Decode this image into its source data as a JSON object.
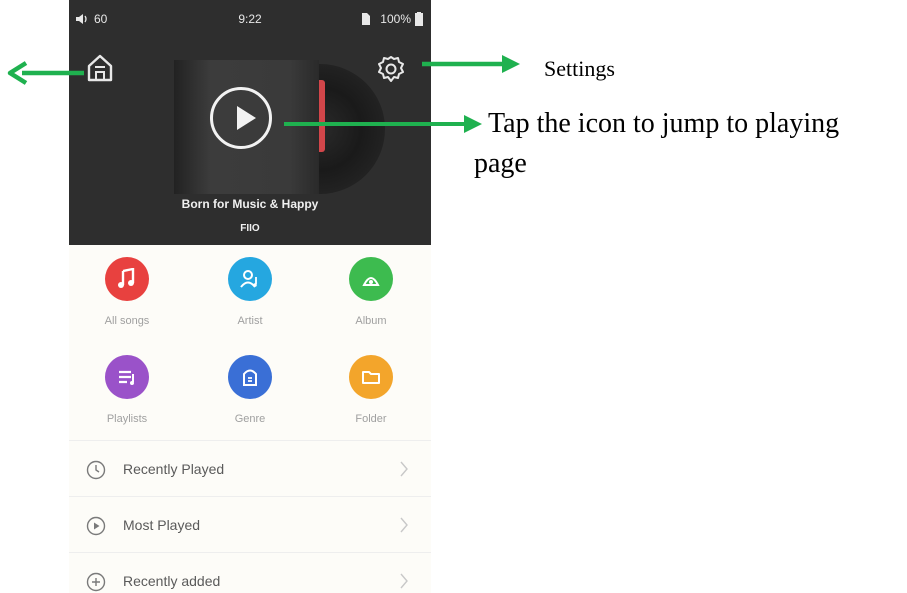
{
  "status_bar": {
    "volume": "60",
    "time": "9:22",
    "battery": "100%"
  },
  "now_playing": {
    "title": "Born for Music & Happy",
    "artist": "FIIO"
  },
  "categories": [
    {
      "label": "All songs",
      "color": "#e8413f",
      "icon": "music-note-icon"
    },
    {
      "label": "Artist",
      "color": "#25a7e0",
      "icon": "artist-icon"
    },
    {
      "label": "Album",
      "color": "#3dbb4f",
      "icon": "album-icon"
    },
    {
      "label": "Playlists",
      "color": "#9a52c9",
      "icon": "playlist-icon"
    },
    {
      "label": "Genre",
      "color": "#3a6fd6",
      "icon": "genre-icon"
    },
    {
      "label": "Folder",
      "color": "#f3a52b",
      "icon": "folder-icon"
    }
  ],
  "list_items": [
    {
      "label": "Recently Played",
      "icon": "clock-icon"
    },
    {
      "label": "Most Played",
      "icon": "play-circle-icon"
    },
    {
      "label": "Recently added",
      "icon": "plus-circle-icon"
    }
  ],
  "annotations": {
    "settings": "Settings",
    "play_line1": "Tap the icon to jump to playing",
    "play_line2": "page"
  },
  "colors": {
    "arrow": "#1fb14f",
    "hero_bg": "#2e2e2e",
    "list_bg": "#fdfcf8"
  }
}
